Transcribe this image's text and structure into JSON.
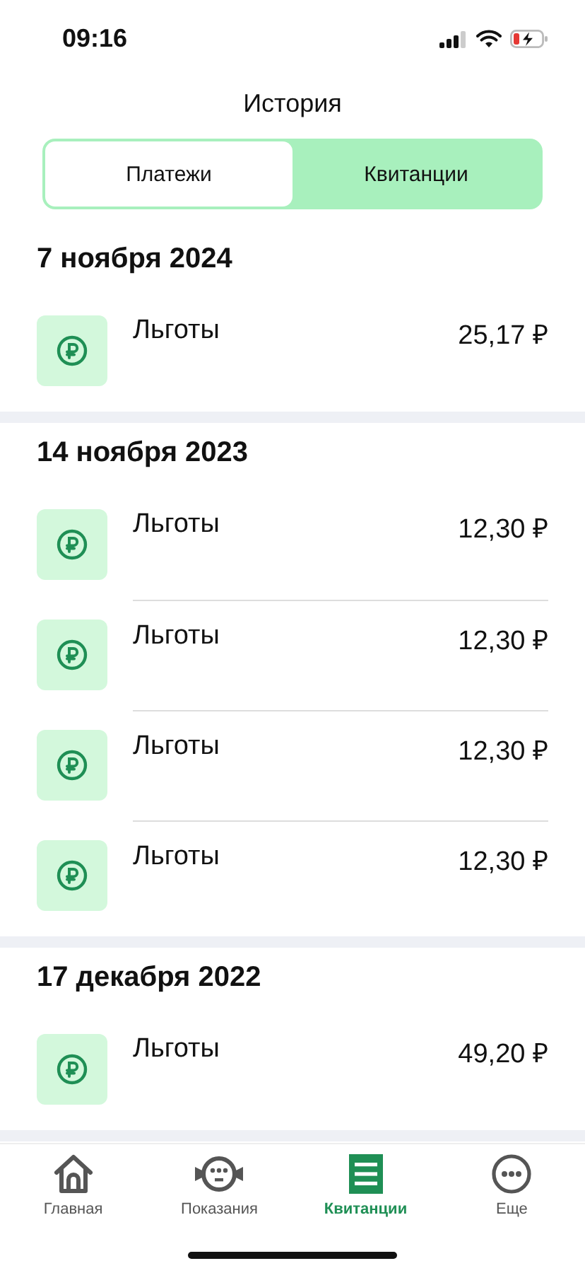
{
  "status_bar": {
    "time": "09:16"
  },
  "title": "История",
  "tabs": [
    {
      "label": "Платежи",
      "selected": true
    },
    {
      "label": "Квитанции",
      "selected": false
    }
  ],
  "sections": [
    {
      "date": "7 ноября 2024",
      "items": [
        {
          "name": "Льготы",
          "amount": "25,17 ₽"
        }
      ]
    },
    {
      "date": "14 ноября 2023",
      "items": [
        {
          "name": "Льготы",
          "amount": "12,30 ₽"
        },
        {
          "name": "Льготы",
          "amount": "12,30 ₽"
        },
        {
          "name": "Льготы",
          "amount": "12,30 ₽"
        },
        {
          "name": "Льготы",
          "amount": "12,30 ₽"
        }
      ]
    },
    {
      "date": "17 декабря 2022",
      "items": [
        {
          "name": "Льготы",
          "amount": "49,20 ₽"
        }
      ]
    }
  ],
  "nav": [
    {
      "kind": "home",
      "label": "Главная",
      "selected": false
    },
    {
      "kind": "meter",
      "label": "Показания",
      "selected": false
    },
    {
      "kind": "receipt",
      "label": "Квитанции",
      "selected": true
    },
    {
      "kind": "more",
      "label": "Еще",
      "selected": false
    }
  ]
}
